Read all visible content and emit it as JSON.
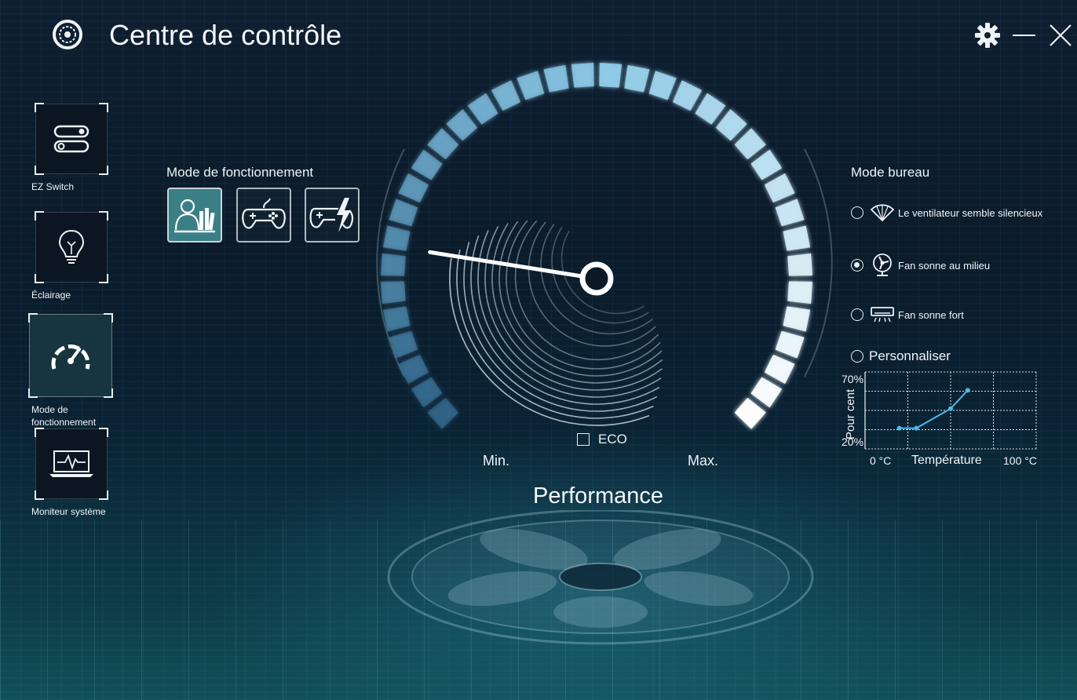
{
  "header": {
    "title": "Centre de contrôle"
  },
  "window_controls": [
    "gear-icon",
    "minimize-icon",
    "close-icon"
  ],
  "sidebar": {
    "items": [
      {
        "label": "EZ Switch",
        "icon": "toggle-switches-icon",
        "active": false
      },
      {
        "label": "Éclairage",
        "icon": "lightbulb-icon",
        "active": false
      },
      {
        "label": "Mode de fonctionnement",
        "icon": "speedometer-icon",
        "active": true
      },
      {
        "label": "Moniteur système",
        "icon": "laptop-pulse-icon",
        "active": false
      }
    ]
  },
  "operating_mode": {
    "title": "Mode de fonctionnement",
    "modes": [
      {
        "icon": "office-person-books-icon",
        "active": true
      },
      {
        "icon": "gamepad-icon",
        "active": false
      },
      {
        "icon": "gamepad-turbo-icon",
        "active": false
      }
    ]
  },
  "gauge": {
    "min_label": "Min.",
    "max_label": "Max.",
    "eco_label": "ECO",
    "eco_checked": false,
    "mode_label": "Performance",
    "level": 0.05,
    "accent": "#8fd4f2"
  },
  "desktop_mode": {
    "title": "Mode bureau",
    "options": [
      {
        "label": "Le ventilateur semble silencieux",
        "icon": "hand-fan-icon",
        "checked": false
      },
      {
        "label": "Fan sonne au milieu",
        "icon": "desk-fan-icon",
        "checked": true
      },
      {
        "label": "Fan sonne fort",
        "icon": "air-conditioner-icon",
        "checked": false
      },
      {
        "label": "Personnaliser",
        "icon": "",
        "checked": false
      }
    ]
  },
  "chart_data": {
    "type": "line",
    "title": "",
    "xlabel": "Température",
    "ylabel": "Pour cent",
    "x_tick_labels": [
      "0 °C",
      "100 °C"
    ],
    "y_tick_labels": [
      "20%",
      "70%"
    ],
    "xlim": [
      0,
      100
    ],
    "ylim": [
      20,
      70
    ],
    "grid": true,
    "color": "#4fb8e8",
    "series": [
      {
        "x": [
          20,
          30,
          50,
          60
        ],
        "y": [
          31,
          31,
          46,
          60
        ]
      }
    ]
  }
}
